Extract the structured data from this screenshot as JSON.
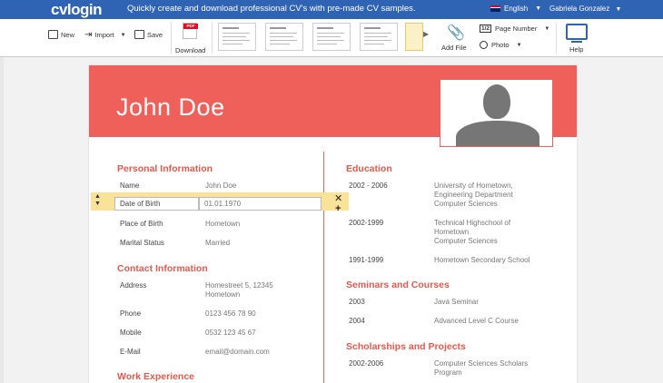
{
  "app": {
    "logo": "cvlogin",
    "tagline": "Quickly create and download professional CV's with pre-made CV samples.",
    "language": "English",
    "user": "Gabriela Gonzalez"
  },
  "toolbar": {
    "new_label": "New",
    "import_label": "Import",
    "save_label": "Save",
    "download_label": "Download",
    "pdf_badge": "PDF",
    "add_file_label": "Add File",
    "page_number_label": "Page Number",
    "page_number_badge": "1/2",
    "photo_label": "Photo",
    "help_label": "Help"
  },
  "cv": {
    "name": "John Doe",
    "personal": {
      "title": "Personal Information",
      "rows": [
        {
          "label": "Name",
          "value": "John Doe"
        },
        {
          "label": "Date of Birth",
          "value": "01.01.1970"
        },
        {
          "label": "Place of Birth",
          "value": "Hometown"
        },
        {
          "label": "Marital Status",
          "value": "Married"
        }
      ]
    },
    "contact": {
      "title": "Contact Information",
      "address_label": "Address",
      "address_line1": "Homestreet 5, 12345",
      "address_line2": "Hometown",
      "phone_label": "Phone",
      "phone": "0123 456 78 90",
      "mobile_label": "Mobile",
      "mobile": "0532 123 45 67",
      "email_label": "E-Mail",
      "email": "email@domain.com"
    },
    "work_title": "Work Experience",
    "education": {
      "title": "Education",
      "items": [
        {
          "period": "2002 - 2006",
          "l1": "University of Hometown,",
          "l2": "Engineering Department",
          "l3": "Computer Sciences"
        },
        {
          "period": "2002-1999",
          "l1": "Technical Highschool of",
          "l2": "Hometown",
          "l3": "Computer Sciences"
        },
        {
          "period": "1991-1999",
          "l1": "Hometown Secondary School"
        }
      ]
    },
    "seminars": {
      "title": "Seminars and Courses",
      "items": [
        {
          "period": "2003",
          "text": "Java Seminar"
        },
        {
          "period": "2004",
          "text": "Advanced Level C Course"
        }
      ]
    },
    "scholarships": {
      "title": "Scholarships and Projects",
      "items": [
        {
          "period": "2002-2006",
          "l1": "Computer Sciences Scholars",
          "l2": "Program"
        }
      ]
    }
  }
}
